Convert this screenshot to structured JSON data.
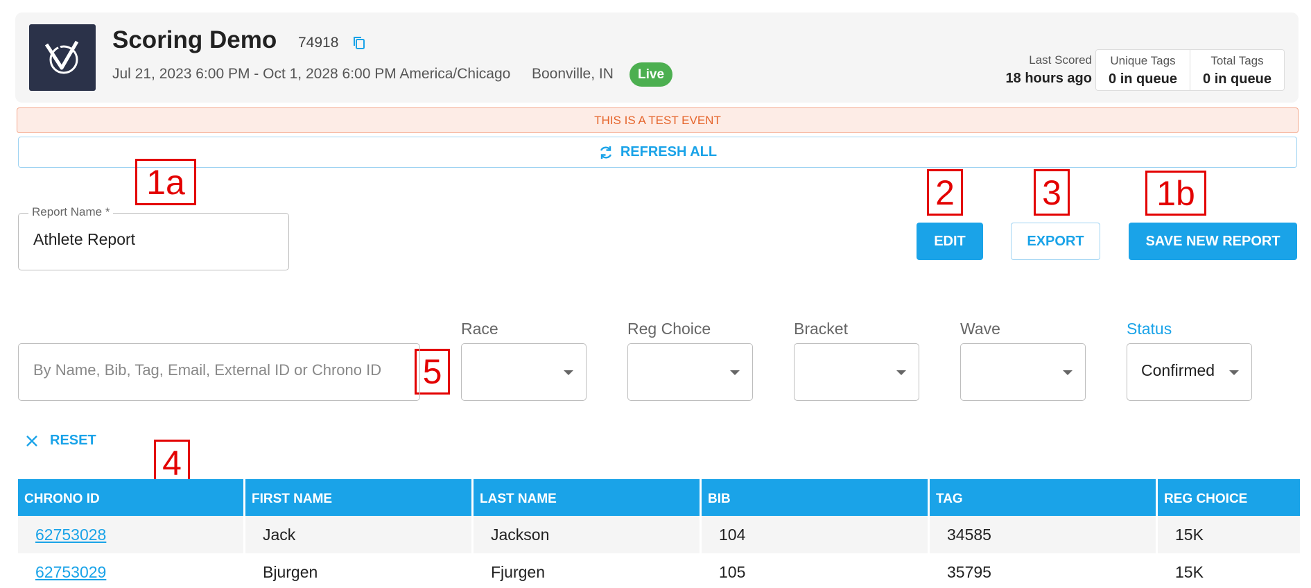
{
  "event": {
    "title": "Scoring Demo",
    "id": "74918",
    "dates": "Jul 21, 2023 6:00 PM - Oct 1, 2028 6:00 PM America/Chicago",
    "location": "Boonville, IN",
    "status": "Live",
    "last_scored_label": "Last Scored",
    "last_scored_value": "18 hours ago",
    "unique_tags_label": "Unique Tags",
    "unique_tags_value": "0 in queue",
    "total_tags_label": "Total Tags",
    "total_tags_value": "0 in queue"
  },
  "banner": {
    "test_event": "THIS IS A TEST EVENT",
    "refresh_all": "REFRESH ALL"
  },
  "report": {
    "name_label": "Report Name *",
    "name_value": "Athlete Report"
  },
  "actions": {
    "edit": "EDIT",
    "export": "EXPORT",
    "save_new": "SAVE NEW REPORT"
  },
  "search": {
    "placeholder": "By Name, Bib, Tag, Email, External ID or Chrono ID"
  },
  "filters": [
    {
      "label": "Race",
      "value": ""
    },
    {
      "label": "Reg Choice",
      "value": ""
    },
    {
      "label": "Bracket",
      "value": ""
    },
    {
      "label": "Wave",
      "value": ""
    },
    {
      "label": "Status",
      "value": "Confirmed"
    }
  ],
  "reset_label": "RESET",
  "annotations": [
    "1a",
    "2",
    "3",
    "1b",
    "5",
    "4"
  ],
  "table": {
    "columns": [
      "CHRONO ID",
      "FIRST NAME",
      "LAST NAME",
      "BIB",
      "TAG",
      "REG CHOICE"
    ],
    "rows": [
      [
        "62753028",
        "Jack",
        "Jackson",
        "104",
        "34585",
        "15K"
      ],
      [
        "62753029",
        "Bjurgen",
        "Fjurgen",
        "105",
        "35795",
        "15K"
      ]
    ]
  },
  "colors": {
    "accent": "#1aa3e8",
    "live": "#4caf50",
    "annotation": "#e30000",
    "logo_bg": "#2b3249",
    "warning": "#e5642b"
  },
  "icons": {
    "copy": "copy-icon",
    "refresh": "refresh-icon",
    "reset": "close-icon",
    "caret": "caret-down-icon"
  }
}
